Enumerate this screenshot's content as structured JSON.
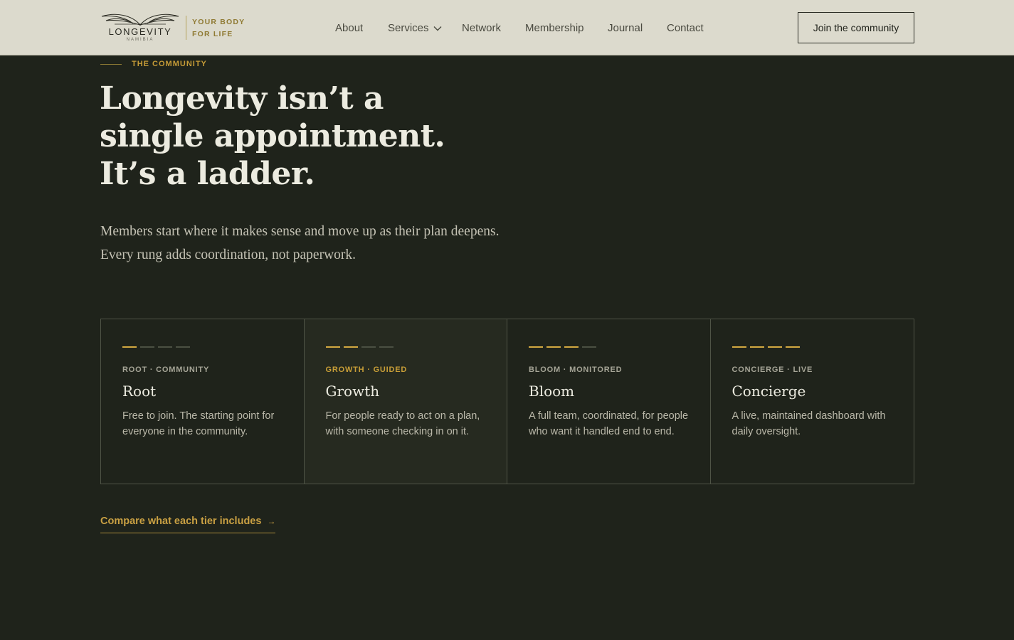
{
  "header": {
    "logo_word": "LONGEVITY",
    "logo_sub": "NAMIBIA",
    "tagline_line1": "YOUR BODY",
    "tagline_line2": "FOR LIFE",
    "nav": [
      "About",
      "Services",
      "Network",
      "Membership",
      "Journal",
      "Contact"
    ],
    "cta_label": "Join the community"
  },
  "hero": {
    "eyebrow": "THE COMMUNITY",
    "headline_line1": "Longevity isn’t a",
    "headline_line2": "single appointment.",
    "headline_line3": "It’s a ladder.",
    "sub_line1": "Members start where it makes sense and move up as their plan deepens.",
    "sub_line2": "Every rung adds coordination, not paperwork."
  },
  "tiers": [
    {
      "tag": "ROOT · COMMUNITY",
      "name": "Root",
      "desc": "Free to join. The starting point for everyone in the community.",
      "level": 1
    },
    {
      "tag": "GROWTH · GUIDED",
      "name": "Growth",
      "desc": "For people ready to act on a plan, with someone checking in on it.",
      "level": 2
    },
    {
      "tag": "BLOOM · MONITORED",
      "name": "Bloom",
      "desc": "A full team, coordinated, for people who want it handled end to end.",
      "level": 3
    },
    {
      "tag": "CONCIERGE · LIVE",
      "name": "Concierge",
      "desc": "A live, maintained dashboard with daily oversight.",
      "level": 4
    }
  ],
  "compare_label": "Compare what each tier includes",
  "compare_arrow": "→",
  "colors": {
    "accent": "#c9a043",
    "background": "#1f231b",
    "header": "#dcdacd"
  }
}
